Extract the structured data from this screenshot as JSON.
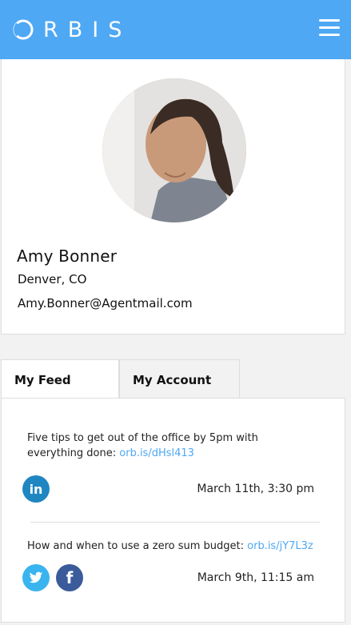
{
  "header": {
    "logo_text": "RBIS",
    "menu_icon": "hamburger-menu-icon",
    "color": "#4ea8f4"
  },
  "profile": {
    "name": "Amy Bonner",
    "location": "Denver, CO",
    "email": "Amy.Bonner@Agentmail.com"
  },
  "tabs": [
    {
      "label": "My Feed",
      "active": true
    },
    {
      "label": "My Account",
      "active": false
    }
  ],
  "feed": [
    {
      "text": "Five tips to get out of the office by 5pm with everything done: ",
      "link": "orb.is/dHsl413",
      "date": "March 11th, 3:30 pm",
      "networks": [
        "linkedin-icon"
      ]
    },
    {
      "text": "How and when to use a zero sum budget: ",
      "link": "orb.is/jY7L3z",
      "date": "March 9th, 11:15 am",
      "networks": [
        "twitter-icon",
        "facebook-icon"
      ]
    }
  ]
}
